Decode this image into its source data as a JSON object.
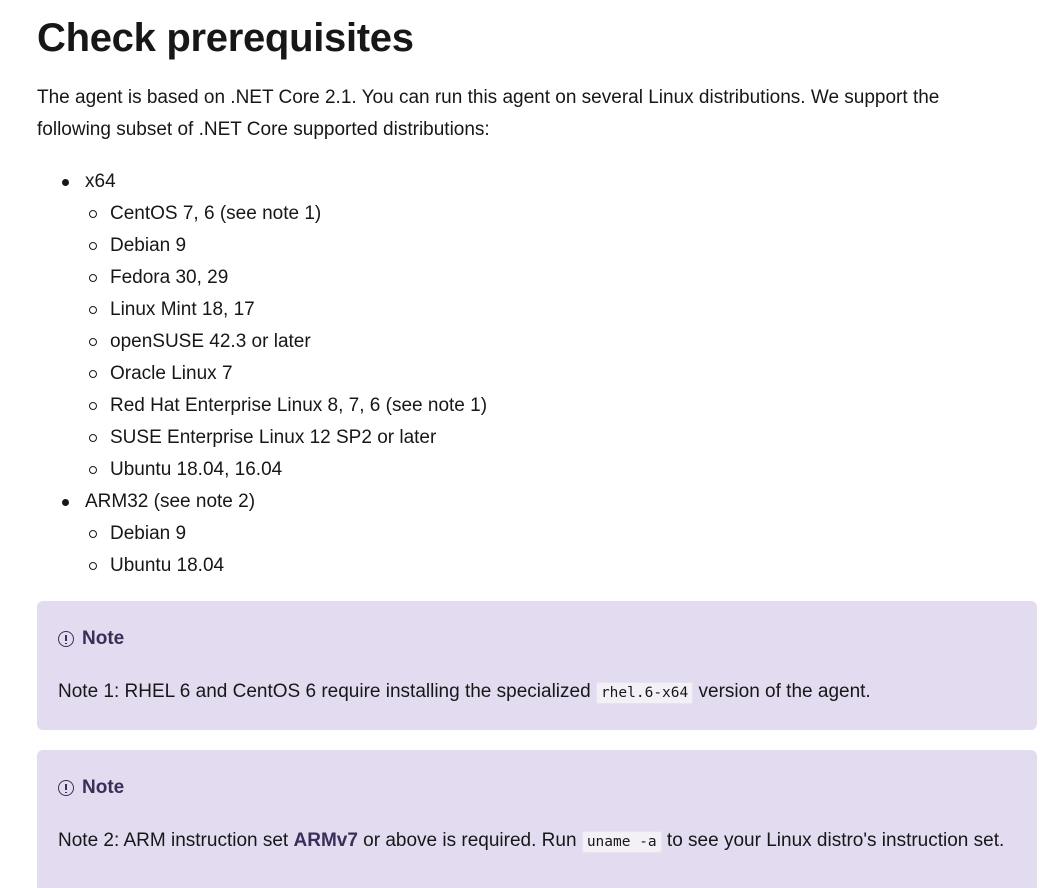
{
  "title": "Check prerequisites",
  "intro": "The agent is based on .NET Core 2.1. You can run this agent on several Linux distributions. We support the following subset of .NET Core supported distributions:",
  "distributions": [
    {
      "label": "x64",
      "items": [
        "CentOS 7, 6 (see note 1)",
        "Debian 9",
        "Fedora 30, 29",
        "Linux Mint 18, 17",
        "openSUSE 42.3 or later",
        "Oracle Linux 7",
        "Red Hat Enterprise Linux 8, 7, 6 (see note 1)",
        "SUSE Enterprise Linux 12 SP2 or later",
        "Ubuntu 18.04, 16.04"
      ]
    },
    {
      "label": "ARM32 (see note 2)",
      "items": [
        "Debian 9",
        "Ubuntu 18.04"
      ]
    }
  ],
  "notes": [
    {
      "icon": "info-icon",
      "heading": "Note",
      "text_before": "Note 1: RHEL 6 and CentOS 6 require installing the specialized ",
      "code": "rhel.6-x64",
      "text_after": " version of the agent."
    },
    {
      "icon": "info-icon",
      "heading": "Note",
      "text_before": "Note 2: ARM instruction set ",
      "strong": "ARMv7",
      "text_middle": " or above is required. Run ",
      "code": "uname -a",
      "text_after": " to see your Linux distro's instruction set."
    }
  ],
  "colors": {
    "note_background": "#e3dcf1",
    "note_heading": "#3b2e58",
    "text": "#171717"
  }
}
